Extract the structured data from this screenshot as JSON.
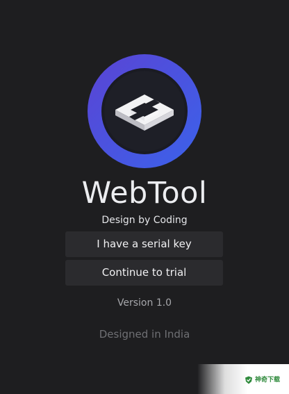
{
  "app": {
    "title": "WebTool",
    "tagline": "Design by Coding",
    "version": "Version 1.0",
    "origin": "Designed in India"
  },
  "logo": {
    "icon": "webtool-cube-logo-icon",
    "gradient_start": "#5248d8",
    "gradient_end": "#3f5ee8",
    "ring_color": "#191a22"
  },
  "actions": {
    "serial_key_label": "I have a serial key",
    "trial_label": "Continue to trial"
  },
  "watermark": {
    "text": "神奇下载",
    "icon": "shield-icon",
    "color": "#2f8a3c"
  },
  "colors": {
    "background": "#1e1e20",
    "button_bg": "#2b2b2e"
  }
}
